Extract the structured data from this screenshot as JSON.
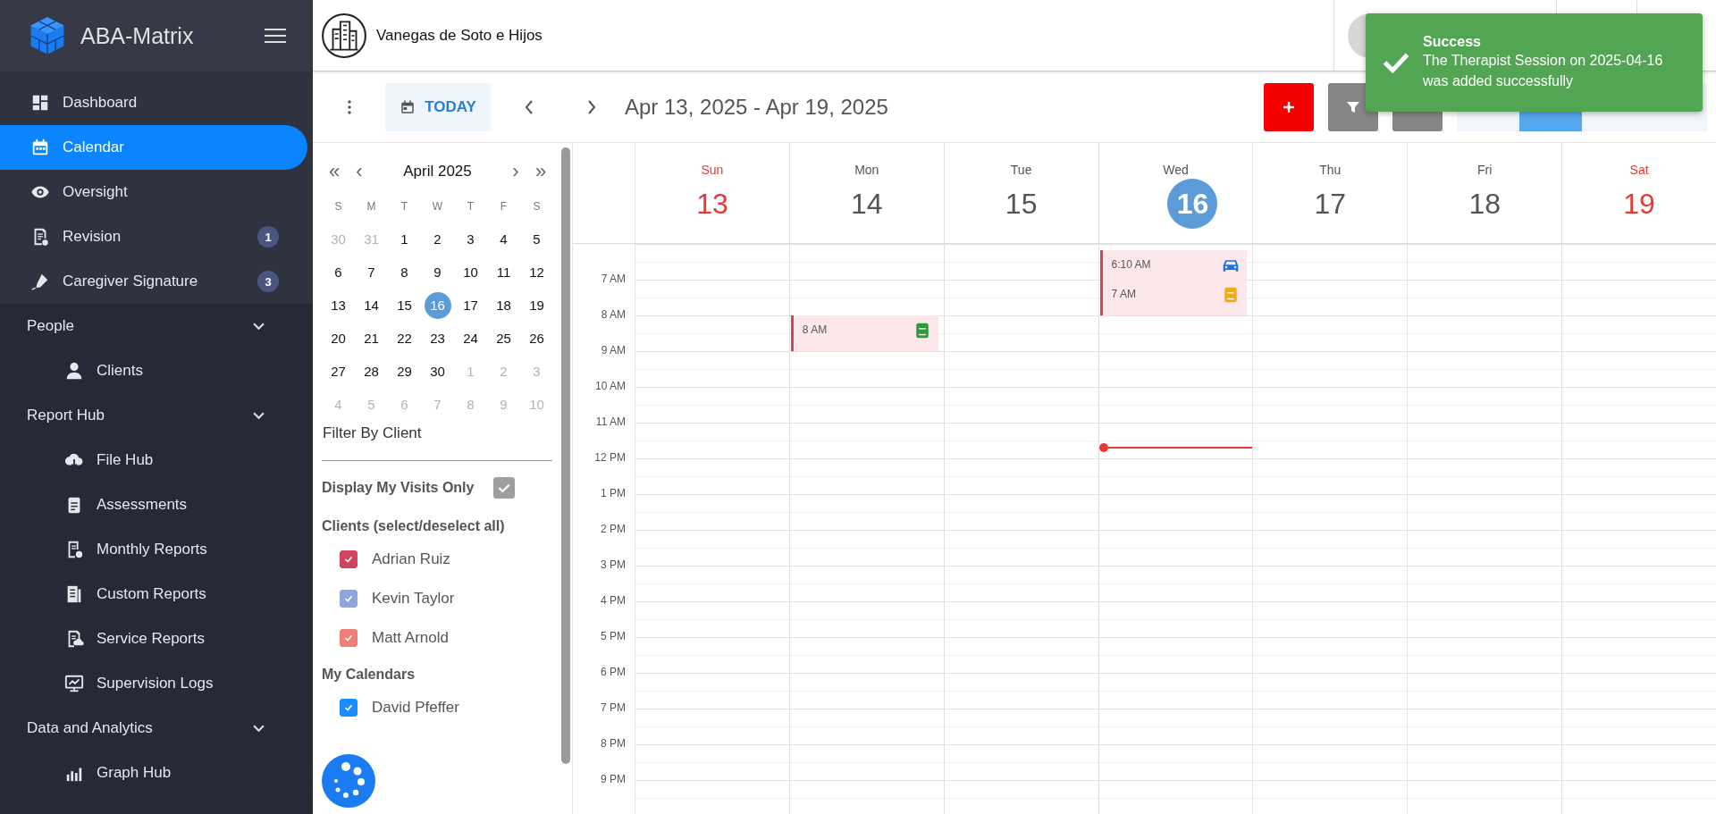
{
  "sidebar": {
    "brand": "ABA-Matrix",
    "items": [
      {
        "label": "Dashboard",
        "selected": false
      },
      {
        "label": "Calendar",
        "selected": true
      },
      {
        "label": "Oversight",
        "selected": false
      },
      {
        "label": "Revision",
        "selected": false,
        "badge": "1"
      },
      {
        "label": "Caregiver Signature",
        "selected": false,
        "badge": "3"
      }
    ],
    "groups": [
      {
        "title": "People",
        "expanded": true,
        "items": [
          {
            "label": "Clients",
            "selected": false
          }
        ]
      },
      {
        "title": "Report Hub",
        "expanded": true,
        "items": [
          {
            "label": "File Hub",
            "selected": false
          },
          {
            "label": "Assessments",
            "selected": false
          },
          {
            "label": "Monthly Reports",
            "selected": false
          },
          {
            "label": "Custom Reports",
            "selected": false
          },
          {
            "label": "Service Reports",
            "selected": false
          },
          {
            "label": "Supervision Logs",
            "selected": false
          }
        ]
      },
      {
        "title": "Data and Analytics",
        "expanded": true,
        "items": [
          {
            "label": "Graph Hub",
            "selected": false
          }
        ]
      }
    ]
  },
  "header": {
    "organization": "Vanegas de Soto e Hijos"
  },
  "toolbar": {
    "today": "TODAY",
    "range": "Apr 13, 2025 - Apr 19, 2025",
    "view_tabs": [
      {
        "selected": false
      },
      {
        "selected": true
      },
      {
        "selected": false
      },
      {
        "selected": false
      }
    ]
  },
  "mini_calendar": {
    "prev_year": "«",
    "prev_month": "‹",
    "title": "April 2025",
    "next_month": "›",
    "next_year": "»",
    "weekdays": [
      "S",
      "M",
      "T",
      "W",
      "T",
      "F",
      "S"
    ],
    "days": [
      {
        "d": "30",
        "muted": true,
        "selected": false
      },
      {
        "d": "31",
        "muted": true,
        "selected": false
      },
      {
        "d": "1",
        "muted": false,
        "selected": false
      },
      {
        "d": "2",
        "muted": false,
        "selected": false
      },
      {
        "d": "3",
        "muted": false,
        "selected": false
      },
      {
        "d": "4",
        "muted": false,
        "selected": false
      },
      {
        "d": "5",
        "muted": false,
        "selected": false
      },
      {
        "d": "6",
        "muted": false,
        "selected": false
      },
      {
        "d": "7",
        "muted": false,
        "selected": false
      },
      {
        "d": "8",
        "muted": false,
        "selected": false
      },
      {
        "d": "9",
        "muted": false,
        "selected": false
      },
      {
        "d": "10",
        "muted": false,
        "selected": false
      },
      {
        "d": "11",
        "muted": false,
        "selected": false
      },
      {
        "d": "12",
        "muted": false,
        "selected": false
      },
      {
        "d": "13",
        "muted": false,
        "selected": false
      },
      {
        "d": "14",
        "muted": false,
        "selected": false
      },
      {
        "d": "15",
        "muted": false,
        "selected": false
      },
      {
        "d": "16",
        "muted": false,
        "selected": true
      },
      {
        "d": "17",
        "muted": false,
        "selected": false
      },
      {
        "d": "18",
        "muted": false,
        "selected": false
      },
      {
        "d": "19",
        "muted": false,
        "selected": false
      },
      {
        "d": "20",
        "muted": false,
        "selected": false
      },
      {
        "d": "21",
        "muted": false,
        "selected": false
      },
      {
        "d": "22",
        "muted": false,
        "selected": false
      },
      {
        "d": "23",
        "muted": false,
        "selected": false
      },
      {
        "d": "24",
        "muted": false,
        "selected": false
      },
      {
        "d": "25",
        "muted": false,
        "selected": false
      },
      {
        "d": "26",
        "muted": false,
        "selected": false
      },
      {
        "d": "27",
        "muted": false,
        "selected": false
      },
      {
        "d": "28",
        "muted": false,
        "selected": false
      },
      {
        "d": "29",
        "muted": false,
        "selected": false
      },
      {
        "d": "30",
        "muted": false,
        "selected": false
      },
      {
        "d": "1",
        "muted": true,
        "selected": false
      },
      {
        "d": "2",
        "muted": true,
        "selected": false
      },
      {
        "d": "3",
        "muted": true,
        "selected": false
      },
      {
        "d": "4",
        "muted": true,
        "selected": false
      },
      {
        "d": "5",
        "muted": true,
        "selected": false
      },
      {
        "d": "6",
        "muted": true,
        "selected": false
      },
      {
        "d": "7",
        "muted": true,
        "selected": false
      },
      {
        "d": "8",
        "muted": true,
        "selected": false
      },
      {
        "d": "9",
        "muted": true,
        "selected": false
      },
      {
        "d": "10",
        "muted": true,
        "selected": false
      }
    ]
  },
  "filters": {
    "filter_label": "Filter By Client",
    "my_visits": {
      "label": "Display My Visits Only",
      "checked": true
    },
    "clients_title": "Clients (select/deselect all)",
    "clients": [
      {
        "name": "Adrian Ruiz",
        "checked": true,
        "color": "#d2435f"
      },
      {
        "name": "Kevin Taylor",
        "checked": true,
        "color": "#8ea6dc"
      },
      {
        "name": "Matt Arnold",
        "checked": true,
        "color": "#ef7e74"
      }
    ],
    "calendars_title": "My Calendars",
    "calendars": [
      {
        "name": "David Pfeffer",
        "checked": true,
        "color": "#1a8cff"
      }
    ]
  },
  "week": {
    "days": [
      {
        "name": "Sun",
        "date": "13",
        "weekend": true,
        "today": false,
        "now_line": false
      },
      {
        "name": "Mon",
        "date": "14",
        "weekend": false,
        "today": false,
        "now_line": false,
        "events": [
          {
            "time": "8 AM",
            "kind": "session",
            "color": "#2e9a3a"
          }
        ]
      },
      {
        "name": "Tue",
        "date": "15",
        "weekend": false,
        "today": false,
        "now_line": false
      },
      {
        "name": "Wed",
        "date": "16",
        "weekend": false,
        "today": true,
        "now_line": true,
        "events": [
          {
            "time": "6:10 AM",
            "kind": "travel",
            "color": "#1a73e8"
          },
          {
            "time": "7 AM",
            "kind": "session",
            "color": "#f4a91c"
          }
        ]
      },
      {
        "name": "Thu",
        "date": "17",
        "weekend": false,
        "today": false,
        "now_line": false
      },
      {
        "name": "Fri",
        "date": "18",
        "weekend": false,
        "today": false,
        "now_line": false
      },
      {
        "name": "Sat",
        "date": "19",
        "weekend": true,
        "today": false,
        "now_line": false
      }
    ],
    "hours": [
      "7 AM",
      "8 AM",
      "9 AM",
      "10 AM",
      "11 AM",
      "12 PM",
      "1 PM",
      "2 PM",
      "3 PM",
      "4 PM",
      "5 PM",
      "6 PM",
      "7 PM",
      "8 PM",
      "9 PM"
    ]
  },
  "toast": {
    "title": "Success",
    "message": "The Therapist Session on 2025-04-16 was added successfully"
  }
}
